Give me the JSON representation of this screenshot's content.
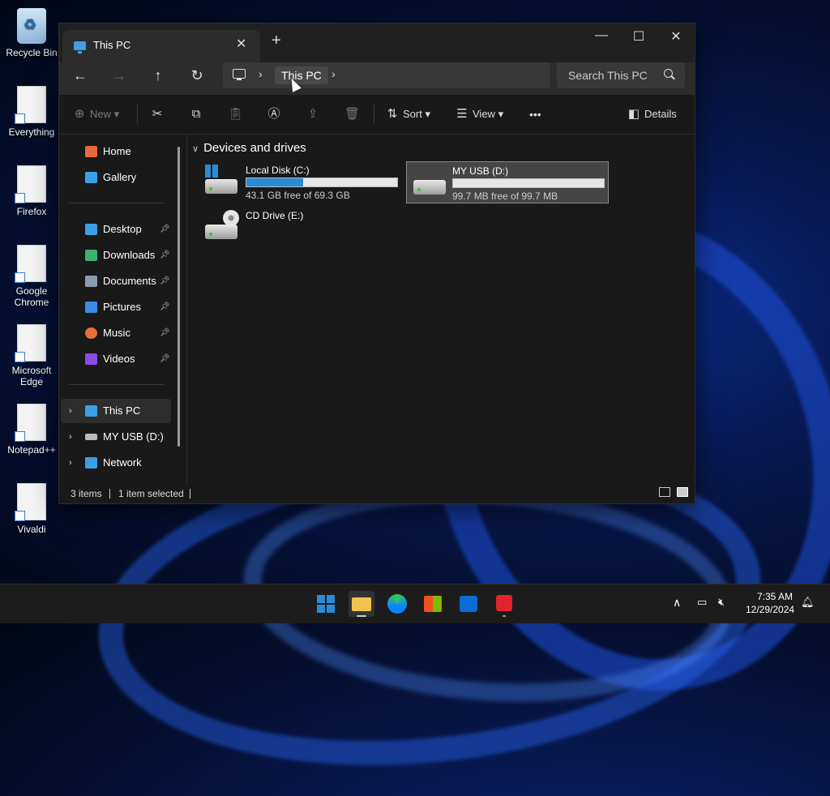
{
  "desktop": {
    "icons": [
      {
        "label": "Recycle Bin",
        "icon": "recycle-bin-icon"
      },
      {
        "label": "Everything",
        "icon": "shortcut-icon"
      },
      {
        "label": "Firefox",
        "icon": "shortcut-icon"
      },
      {
        "label": "Google Chrome",
        "icon": "shortcut-icon"
      },
      {
        "label": "Microsoft Edge",
        "icon": "shortcut-icon"
      },
      {
        "label": "Notepad++",
        "icon": "shortcut-icon"
      },
      {
        "label": "Vivaldi",
        "icon": "shortcut-icon"
      }
    ]
  },
  "window": {
    "tab_title": "This PC",
    "tab_close": "✕",
    "new_tab": "+",
    "controls": {
      "minimize": "—",
      "maximize": "☐",
      "close": "✕"
    }
  },
  "nav": {
    "back": "←",
    "forward": "→",
    "up": "↑",
    "refresh": "↻",
    "breadcrumb": "This PC",
    "search_placeholder": "Search This PC"
  },
  "toolbar": {
    "new_label": "New",
    "sort_label": "Sort",
    "view_label": "View",
    "more": "•••",
    "details_label": "Details"
  },
  "sidebar": {
    "quick": [
      {
        "label": "Home",
        "color": "#e86a3a"
      },
      {
        "label": "Gallery",
        "color": "#3aa0e8"
      }
    ],
    "pinned": [
      {
        "label": "Desktop",
        "color": "#3aa0e8"
      },
      {
        "label": "Downloads",
        "color": "#3bb36b"
      },
      {
        "label": "Documents",
        "color": "#8a9bb0"
      },
      {
        "label": "Pictures",
        "color": "#3a8ce8"
      },
      {
        "label": "Music",
        "color": "#e8703a"
      },
      {
        "label": "Videos",
        "color": "#8a4be8"
      }
    ],
    "tree": [
      {
        "label": "This PC",
        "color": "#3aa0e8",
        "selected": true
      },
      {
        "label": "MY USB (D:)",
        "color": "#bbbbbb",
        "selected": false
      },
      {
        "label": "Network",
        "color": "#3aa0e8",
        "selected": false
      }
    ]
  },
  "content": {
    "section_title": "Devices and drives",
    "drives": [
      {
        "name": "Local Disk (C:)",
        "free_text": "43.1 GB free of 69.3 GB",
        "used_fraction": 0.378
      },
      {
        "name": "MY USB (D:)",
        "free_text": "99.7 MB free of 99.7 MB",
        "used_fraction": 0.0
      },
      {
        "name": "CD Drive (E:)"
      }
    ]
  },
  "status": {
    "item_count": "3 items",
    "selection": "1 item selected"
  },
  "taskbar": {
    "time": "7:35 AM",
    "date": "12/29/2024"
  }
}
